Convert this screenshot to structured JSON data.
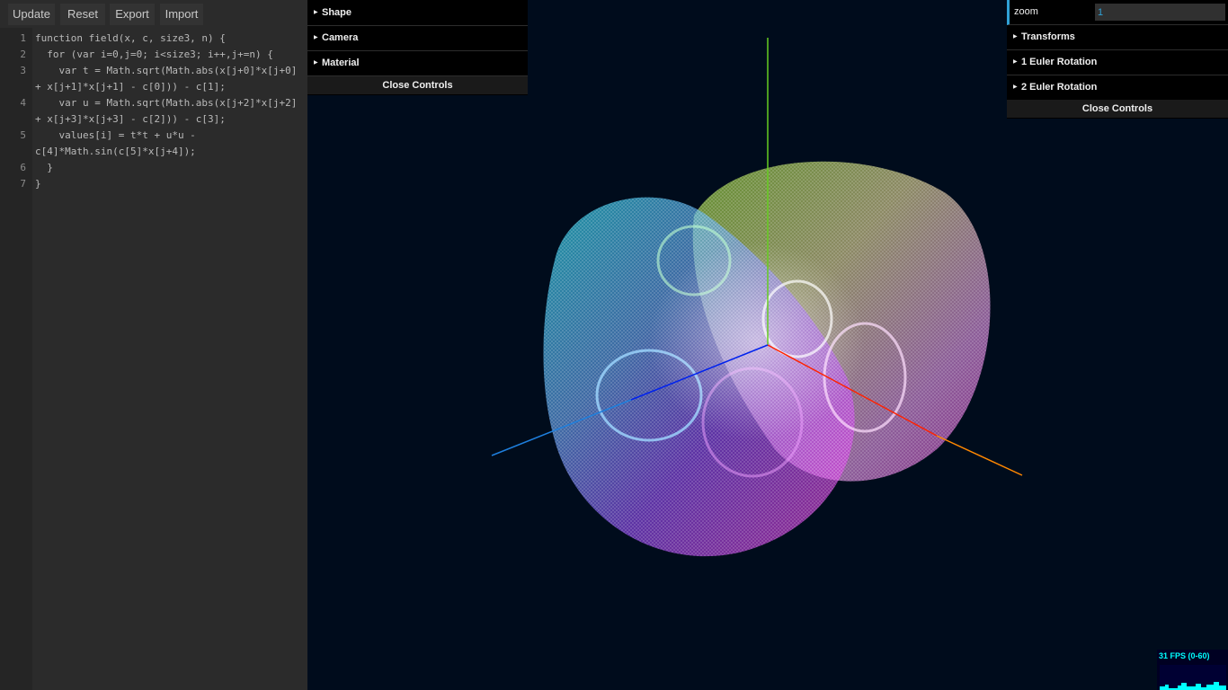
{
  "toolbar": {
    "buttons": [
      "Update",
      "Reset",
      "Export",
      "Import"
    ]
  },
  "editor": {
    "line_numbers": [
      "1",
      "2",
      "3",
      "4",
      "",
      "5",
      "",
      "6",
      "7"
    ],
    "lines": [
      "function field(x, c, size3, n) {",
      "  for (var i=0,j=0; i<size3; i++,j+=n) {",
      "    var t = Math.sqrt(Math.abs(x[j+0]*x[j+0]",
      "+ x[j+1]*x[j+1] - c[0])) - c[1];",
      "    var u = Math.sqrt(Math.abs(x[j+2]*x[j+2]",
      "+ x[j+3]*x[j+3] - c[2])) - c[3];",
      "    values[i] = t*t + u*u -",
      "c[4]*Math.sin(c[5]*x[j+4]);",
      "  }",
      "}"
    ]
  },
  "gui_left": {
    "folders": [
      "Shape",
      "Camera",
      "Material"
    ],
    "close_label": "Close Controls"
  },
  "gui_right": {
    "zoom_label": "zoom",
    "zoom_value": "1",
    "folders": [
      "Transforms",
      "1 Euler Rotation",
      "2 Euler Rotation"
    ],
    "close_label": "Close Controls"
  },
  "stats": {
    "fps_text": "31 FPS (0-60)"
  },
  "colors": {
    "background": "#000c1c",
    "axis_y": "#66cc22",
    "axis_x_red": "#ff2200",
    "axis_x_orange": "#ff8800",
    "axis_z_blue": "#0022ee",
    "axis_z_light": "#1e7fdd",
    "accent": "#2fa1d6",
    "fps": "#00ffff"
  }
}
